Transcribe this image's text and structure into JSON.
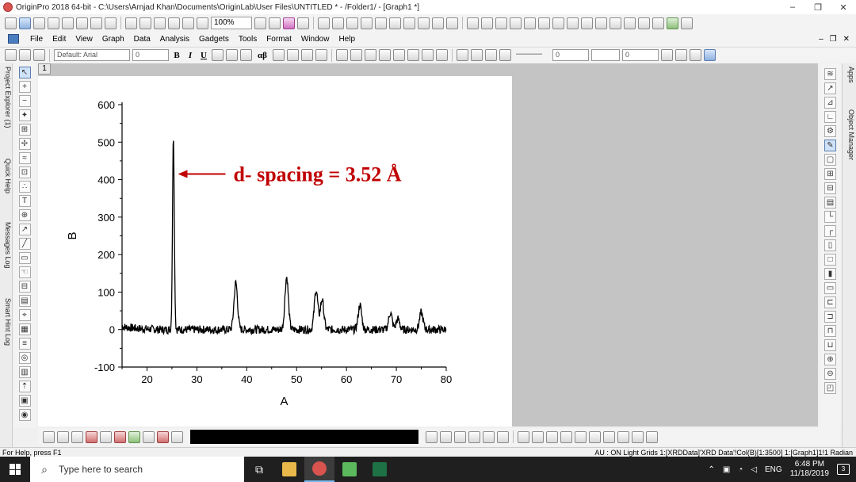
{
  "window": {
    "title": "OriginPro 2018 64-bit - C:\\Users\\Arnjad Khan\\Documents\\OriginLab\\User Files\\UNTITLED * - /Folder1/ - [Graph1 *]",
    "minimize": "–",
    "maximize": "❐",
    "close": "✕"
  },
  "toolbar": {
    "zoom": "100%"
  },
  "menu": [
    "File",
    "Edit",
    "View",
    "Graph",
    "Data",
    "Analysis",
    "Gadgets",
    "Tools",
    "Format",
    "Window",
    "Help"
  ],
  "mdi_controls": {
    "minimize": "–",
    "restore": "❐",
    "close": "✕"
  },
  "format_toolbar": {
    "font": "Default: Arial",
    "size": "0",
    "bold": "B",
    "italic": "I",
    "underline": "U",
    "greek": "αβ",
    "line_width": "0",
    "pattern_width": "0"
  },
  "left_panel_tabs": [
    "Project Explorer (1)",
    "Quick Help",
    "Messages Log",
    "Smart Hint Log"
  ],
  "right_panel_tabs": [
    "Apps",
    "Object Manager"
  ],
  "graph_page": {
    "layer_number": "1"
  },
  "chart_data": {
    "type": "line",
    "title": "",
    "xlabel": "A",
    "ylabel": "B",
    "xlim": [
      15,
      80
    ],
    "ylim": [
      -100,
      600
    ],
    "xticks": [
      20,
      30,
      40,
      50,
      60,
      70,
      80
    ],
    "yticks": [
      -100,
      0,
      100,
      200,
      300,
      400,
      500,
      600
    ],
    "grid": false,
    "peaks": [
      {
        "x": 25.3,
        "y": 515
      },
      {
        "x": 37.8,
        "y": 125
      },
      {
        "x": 48.0,
        "y": 140
      },
      {
        "x": 53.9,
        "y": 105
      },
      {
        "x": 55.1,
        "y": 80
      },
      {
        "x": 62.7,
        "y": 65
      },
      {
        "x": 68.8,
        "y": 45
      },
      {
        "x": 70.3,
        "y": 28
      },
      {
        "x": 75.0,
        "y": 45
      }
    ],
    "baseline": 0,
    "annotation": {
      "text": "d- spacing = 3.52 Å",
      "arrow_to": {
        "x": 26.2,
        "y": 415
      },
      "color": "#c00000"
    }
  },
  "status": {
    "left": "For Help, press F1",
    "right": "AU : ON  Light Grids  1:[XRDData]'XRD Data'!Col(B)[1:3500]  1:[Graph1]1!1  Radian"
  },
  "taskbar": {
    "search_placeholder": "Type here to search",
    "lang": "ENG",
    "time": "6:48 PM",
    "date": "11/18/2019",
    "notifications": "3"
  }
}
